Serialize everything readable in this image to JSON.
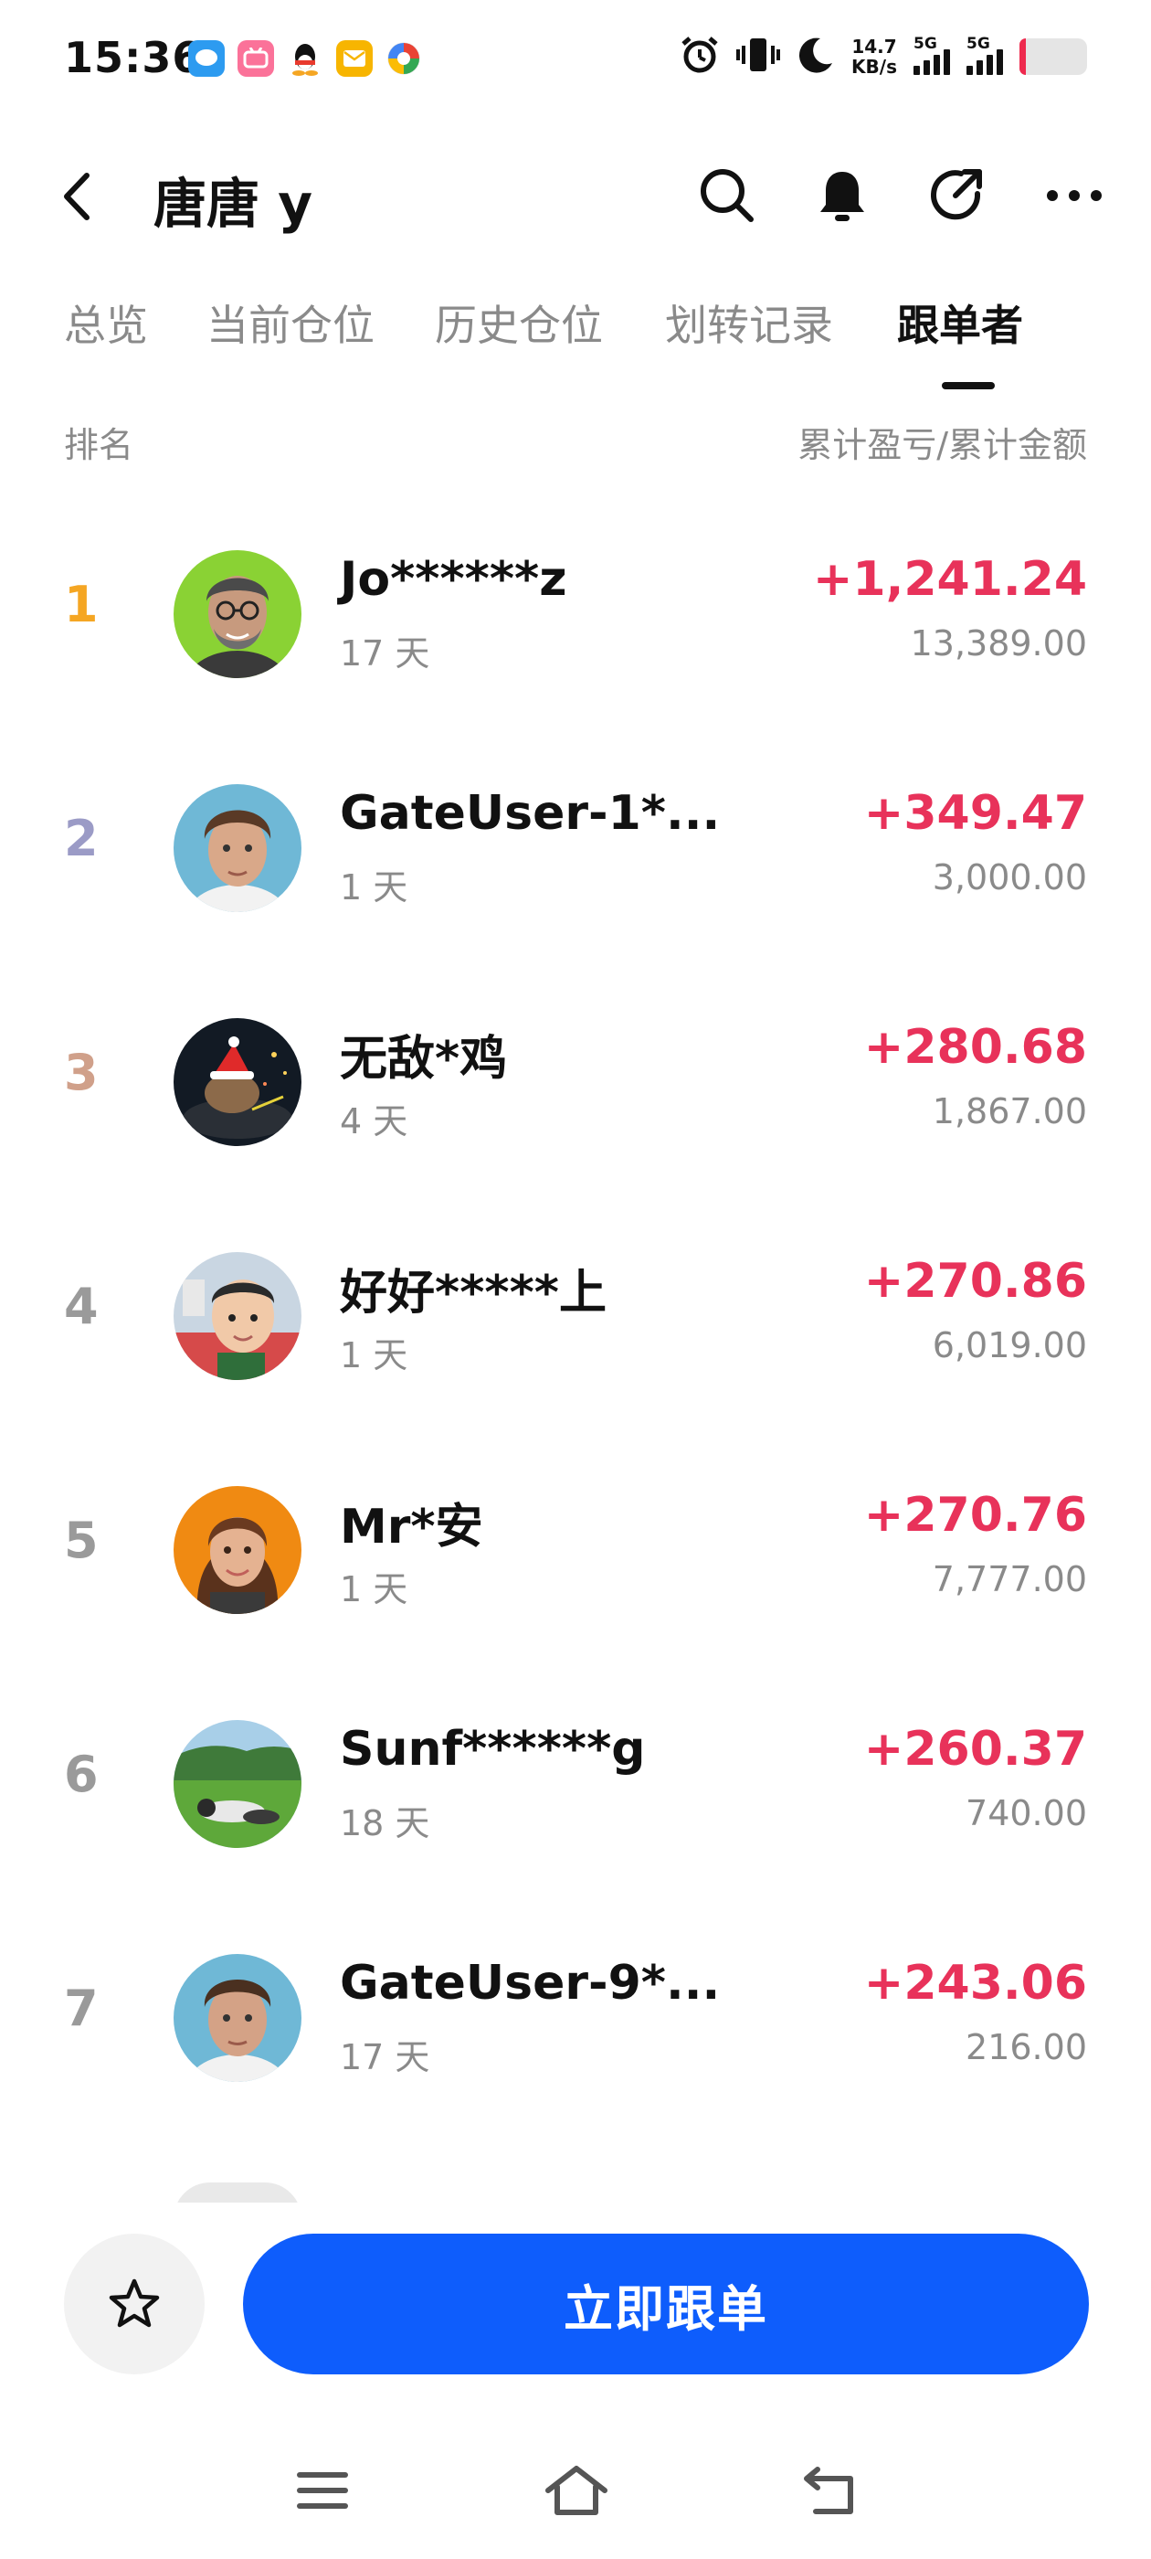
{
  "status_bar": {
    "time": "15:36",
    "net_speed_value": "14.7",
    "net_speed_unit": "KB/s",
    "sim1": "5G",
    "sim2": "5G",
    "battery_level": 0.1
  },
  "header": {
    "title": "唐唐 y",
    "icons": [
      "back-icon",
      "search-icon",
      "bell-icon",
      "share-icon",
      "more-icon"
    ]
  },
  "tabs": [
    {
      "label": "总览",
      "active": false
    },
    {
      "label": "当前仓位",
      "active": false
    },
    {
      "label": "历史仓位",
      "active": false
    },
    {
      "label": "划转记录",
      "active": false
    },
    {
      "label": "跟单者",
      "active": true
    }
  ],
  "list_header": {
    "left": "排名",
    "right": "累计盈亏/累计金额"
  },
  "followers": [
    {
      "rank": "1",
      "name": "Jo******z",
      "days": "17 天",
      "pnl": "+1,241.24",
      "amount": "13,389.00",
      "rank_color": "#f5a623"
    },
    {
      "rank": "2",
      "name": "GateUser-1*...",
      "days": "1 天",
      "pnl": "+349.47",
      "amount": "3,000.00",
      "rank_color": "#9b9bc6"
    },
    {
      "rank": "3",
      "name": "无敌*鸡",
      "days": "4 天",
      "pnl": "+280.68",
      "amount": "1,867.00",
      "rank_color": "#d0a08a"
    },
    {
      "rank": "4",
      "name": "好好*****上",
      "days": "1 天",
      "pnl": "+270.86",
      "amount": "6,019.00",
      "rank_color": "#9a9a9a"
    },
    {
      "rank": "5",
      "name": "Mr*安",
      "days": "1 天",
      "pnl": "+270.76",
      "amount": "7,777.00",
      "rank_color": "#9a9a9a"
    },
    {
      "rank": "6",
      "name": "Sunf******g",
      "days": "18 天",
      "pnl": "+260.37",
      "amount": "740.00",
      "rank_color": "#9a9a9a"
    },
    {
      "rank": "7",
      "name": "GateUser-9*...",
      "days": "17 天",
      "pnl": "+243.06",
      "amount": "216.00",
      "rank_color": "#9a9a9a"
    }
  ],
  "colors": {
    "accent": "#0e5dfc",
    "profit": "#e8325a",
    "muted": "#8a8a8a"
  },
  "action_bar": {
    "follow_label": "立即跟单",
    "fav_icon": "star-icon"
  },
  "system_nav": [
    "menu-icon",
    "home-icon",
    "back-nav-icon"
  ]
}
